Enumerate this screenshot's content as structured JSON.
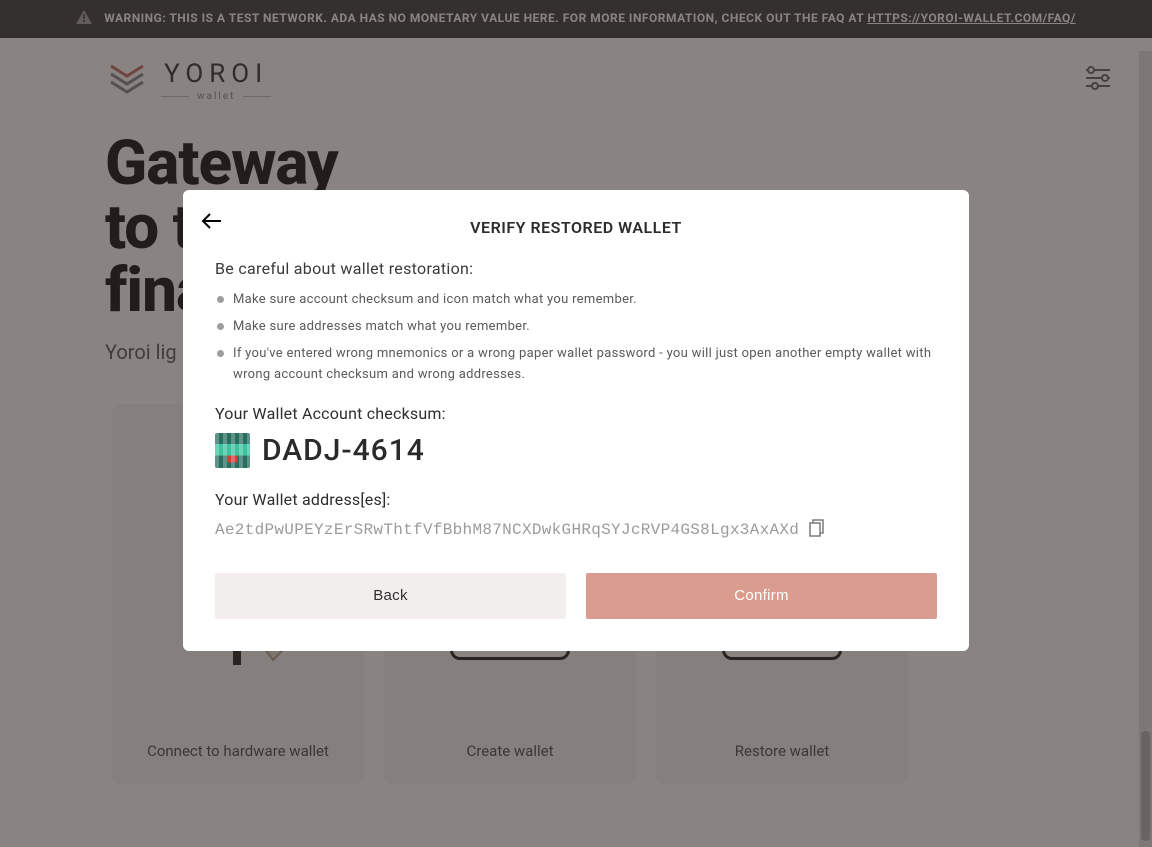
{
  "banner": {
    "text_prefix": "WARNING: THIS IS A TEST NETWORK. ADA HAS NO MONETARY VALUE HERE. FOR MORE INFORMATION, CHECK OUT THE FAQ AT ",
    "link_text": "HTTPS://YOROI-WALLET.COM/FAQ/"
  },
  "logo": {
    "word": "YOROI",
    "sub": "wallet"
  },
  "hero": {
    "title_line1": "Gateway",
    "title_line2": "to the",
    "title_line3": "financial",
    "subtitle": "Yoroi lig"
  },
  "cards": {
    "connect": "Connect to hardware wallet",
    "create": "Create wallet",
    "restore": "Restore wallet"
  },
  "modal": {
    "title": "VERIFY RESTORED WALLET",
    "caution": "Be careful about wallet restoration:",
    "bullets": [
      "Make sure account checksum and icon match what you remember.",
      "Make sure addresses match what you remember.",
      "If you've entered wrong mnemonics or a wrong paper wallet password - you will just open another empty wallet with wrong account checksum and wrong addresses."
    ],
    "checksum_label": "Your Wallet Account checksum:",
    "checksum_value": "DADJ-4614",
    "addresses_label": "Your Wallet address[es]:",
    "address": "Ae2tdPwUPEYzErSRwThtfVfBbhM87NCXDwkGHRqSYJcRVP4GS8Lgx3AxAXd",
    "back_label": "Back",
    "confirm_label": "Confirm"
  }
}
